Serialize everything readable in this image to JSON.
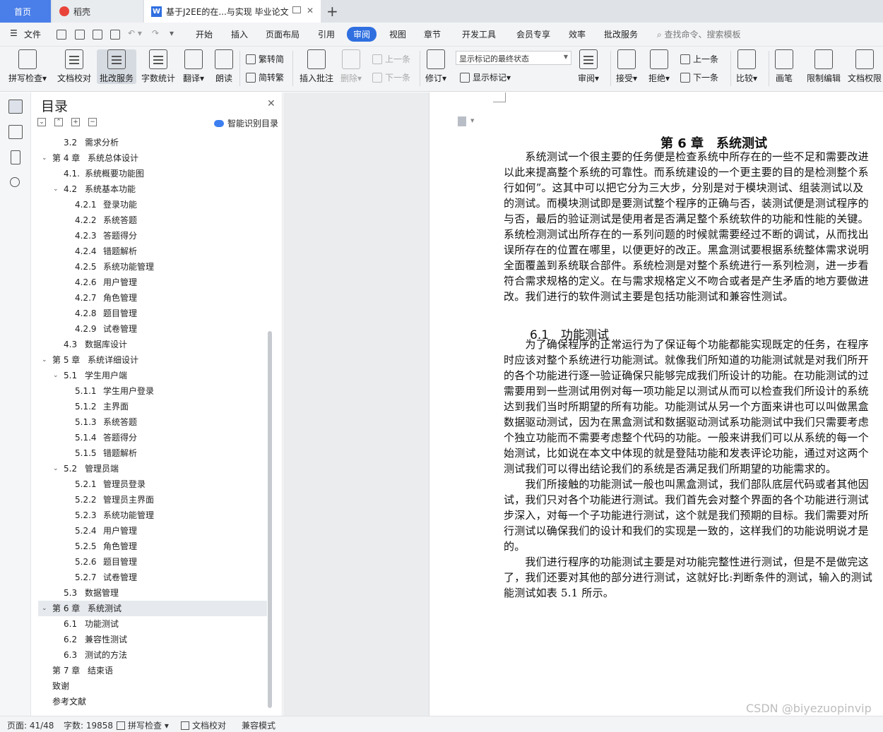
{
  "tabs": {
    "home": "首页",
    "docer": "稻壳",
    "doc": "基于J2EE的在...与实现 毕业论文",
    "add": "+"
  },
  "menu": {
    "file": "文件",
    "items": [
      "开始",
      "插入",
      "页面布局",
      "引用",
      "审阅",
      "视图",
      "章节",
      "开发工具",
      "会员专享",
      "效率",
      "批改服务"
    ],
    "active": "审阅",
    "search": "查找命令、搜索模板"
  },
  "ribbon": {
    "spellcheck": "拼写检查",
    "doc_proof": "文档校对",
    "revise_service": "批改服务",
    "word_count": "字数统计",
    "translate": "翻译",
    "read_aloud": "朗读",
    "trad": "繁转简",
    "simp": "简转繁",
    "insert_comment": "插入批注",
    "delete": "删除",
    "prev_comment": "上一条",
    "next_comment": "下一条",
    "track": "修订",
    "markup_state": "显示标记的最终状态",
    "show_markup": "显示标记",
    "review": "审阅",
    "accept": "接受",
    "reject": "拒绝",
    "prev_change": "上一条",
    "next_change": "下一条",
    "compare": "比较",
    "pen": "画笔",
    "restrict": "限制编辑",
    "doc_perm": "文档权限"
  },
  "toc": {
    "title": "目录",
    "smart": "智能识别目录",
    "items": [
      {
        "level": 2,
        "num": "3.2",
        "text": "需求分析",
        "caret": ""
      },
      {
        "level": 1,
        "num": "第 4 章",
        "text": "系统总体设计",
        "caret": "v"
      },
      {
        "level": 2,
        "num": "4.1.",
        "text": "系统概要功能图",
        "caret": ""
      },
      {
        "level": 2,
        "num": "4.2",
        "text": "系统基本功能",
        "caret": "v"
      },
      {
        "level": 3,
        "num": "4.2.1",
        "text": "登录功能",
        "caret": ""
      },
      {
        "level": 3,
        "num": "4.2.2",
        "text": "系统答题",
        "caret": ""
      },
      {
        "level": 3,
        "num": "4.2.3",
        "text": "答题得分",
        "caret": ""
      },
      {
        "level": 3,
        "num": "4.2.4",
        "text": "错题解析",
        "caret": ""
      },
      {
        "level": 3,
        "num": "4.2.5",
        "text": "系统功能管理",
        "caret": ""
      },
      {
        "level": 3,
        "num": "4.2.6",
        "text": "用户管理",
        "caret": ""
      },
      {
        "level": 3,
        "num": "4.2.7",
        "text": "角色管理",
        "caret": ""
      },
      {
        "level": 3,
        "num": "4.2.8",
        "text": "题目管理",
        "caret": ""
      },
      {
        "level": 3,
        "num": "4.2.9",
        "text": "试卷管理",
        "caret": ""
      },
      {
        "level": 2,
        "num": "4.3",
        "text": "数据库设计",
        "caret": ""
      },
      {
        "level": 1,
        "num": "第 5 章",
        "text": "系统详细设计",
        "caret": "v"
      },
      {
        "level": 2,
        "num": "5.1",
        "text": "学生用户端",
        "caret": "v"
      },
      {
        "level": 3,
        "num": "5.1.1",
        "text": "学生用户登录",
        "caret": ""
      },
      {
        "level": 3,
        "num": "5.1.2",
        "text": "主界面",
        "caret": ""
      },
      {
        "level": 3,
        "num": "5.1.3",
        "text": "系统答题",
        "caret": ""
      },
      {
        "level": 3,
        "num": "5.1.4",
        "text": "答题得分",
        "caret": ""
      },
      {
        "level": 3,
        "num": "5.1.5",
        "text": "错题解析",
        "caret": ""
      },
      {
        "level": 2,
        "num": "5.2",
        "text": "管理员端",
        "caret": "v"
      },
      {
        "level": 3,
        "num": "5.2.1",
        "text": "管理员登录",
        "caret": ""
      },
      {
        "level": 3,
        "num": "5.2.2",
        "text": "管理员主界面",
        "caret": ""
      },
      {
        "level": 3,
        "num": "5.2.3",
        "text": "系统功能管理",
        "caret": ""
      },
      {
        "level": 3,
        "num": "5.2.4",
        "text": "用户管理",
        "caret": ""
      },
      {
        "level": 3,
        "num": "5.2.5",
        "text": "角色管理",
        "caret": ""
      },
      {
        "level": 3,
        "num": "5.2.6",
        "text": "题目管理",
        "caret": ""
      },
      {
        "level": 3,
        "num": "5.2.7",
        "text": "试卷管理",
        "caret": ""
      },
      {
        "level": 2,
        "num": "5.3",
        "text": "数据管理",
        "caret": ""
      },
      {
        "level": 1,
        "num": "第 6 章",
        "text": "系统测试",
        "caret": "v",
        "selected": true
      },
      {
        "level": 2,
        "num": "6.1",
        "text": "功能测试",
        "caret": ""
      },
      {
        "level": 2,
        "num": "6.2",
        "text": "兼容性测试",
        "caret": ""
      },
      {
        "level": 2,
        "num": "6.3",
        "text": "测试的方法",
        "caret": ""
      },
      {
        "level": 1,
        "num": "第 7 章",
        "text": "结束语",
        "caret": ""
      },
      {
        "level": 1,
        "num": "致谢",
        "text": "",
        "caret": ""
      },
      {
        "level": 1,
        "num": "参考文献",
        "text": "",
        "caret": ""
      }
    ]
  },
  "document": {
    "chapter_title": "第 6 章　系统测试",
    "section_title": "6.1　功能测试",
    "lines": [
      "　　系统测试一个很主要的任务便是检查系统中所存在的一些不足和需要改进",
      "以此来提高整个系统的可靠性。而系统建设的一个更主要的目的是检测整个系",
      "行如何”。这其中可以把它分为三大步，分别是对于模块测试、组装测试以及",
      "的测试。而模块测试即是要测试整个程序的正确与否，装测试便是测试程序的",
      "与否，最后的验证测试是使用者是否满足整个系统软件的功能和性能的关键。",
      "系统检测测试出所存在的一系列问题的时候就需要经过不断的调试，从而找出",
      "误所存在的位置在哪里，以便更好的改正。黑盒测试要根据系统整体需求说明",
      "全面覆盖到系统联合部件。系统检测是对整个系统进行一系列检测，进一步看",
      "符合需求规格的定义。在与需求规格定义不吻合或者是产生矛盾的地方要做进",
      "改。我们进行的软件测试主要是包括功能测试和兼容性测试。",
      "　　为了确保程序的正常运行为了保证每个功能都能实现既定的任务，在程序",
      "时应该对整个系统进行功能测试。就像我们所知道的功能测试就是对我们所开",
      "的各个功能进行逐一验证确保只能够完成我们所设计的功能。在功能测试的过",
      "需要用到一些测试用例对每一项功能足以测试从而可以检查我们所设计的系统",
      "达到我们当时所期望的所有功能。功能测试从另一个方面来讲也可以叫做黑盒",
      "数据驱动测试，因为在黑盒测试和数据驱动测试系功能测试中我们只需要考虑",
      "个独立功能而不需要考虑整个代码的功能。一般来讲我们可以从系统的每一个",
      "始测试，比如说在本文中体现的就是登陆功能和发表评论功能，通过对这两个",
      "测试我们可以得出结论我们的系统是否满足我们所期望的功能需求的。",
      "　　我们所接触的功能测试一般也叫黑盒测试，我们部队底层代码或者其他因",
      "试，我们只对各个功能进行测试。我们首先会对整个界面的各个功能进行测试",
      "步深入，对每一个子功能进行测试，这个就是我们预期的目标。我们需要对所",
      "行测试以确保我们的设计和我们的实现是一致的，这样我们的功能说明说才是",
      "的。",
      "　　我们进行程序的功能测试主要是对功能完整性进行测试，但是不是做完这",
      "了，我们还要对其他的部分进行测试，这就好比:判断条件的测试，输入的测试",
      "能测试如表 5.1 所示。"
    ]
  },
  "status": {
    "page": "页面: 41/48",
    "words": "字数: 19858",
    "spell": "拼写检查",
    "proof": "文档校对",
    "mode": "兼容模式"
  },
  "watermark": "CSDN @biyezuopinvip",
  "colors": {
    "accent": "#2f6fe0",
    "home_tab": "#4a7ee8"
  }
}
